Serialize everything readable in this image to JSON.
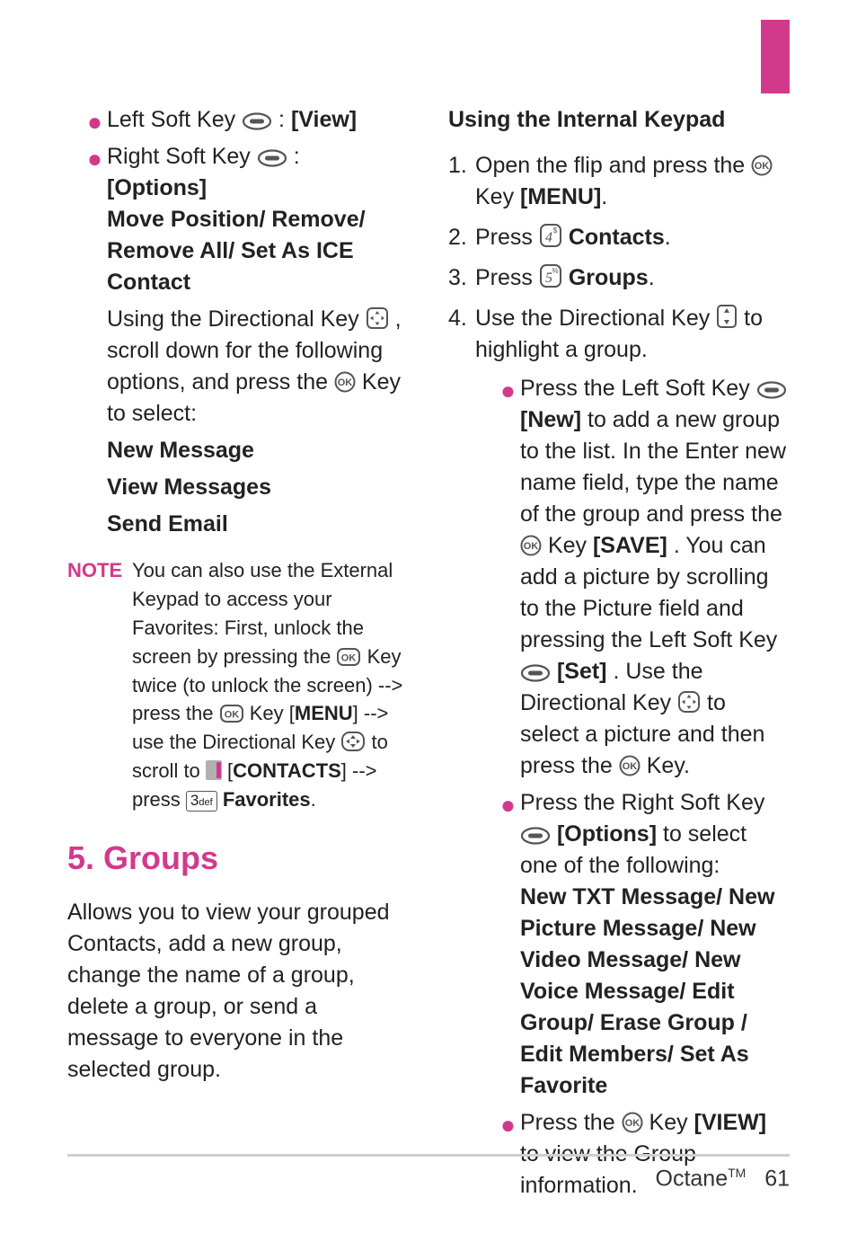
{
  "left": {
    "b1": {
      "pre": "Left Soft Key ",
      "post": ": ",
      "label": "[View]"
    },
    "b2": {
      "pre": "Right Soft Key ",
      "post": ":",
      "opt": "[Options]",
      "opts": "Move Position/ Remove/ Remove All/ Set As ICE Contact"
    },
    "dir_a": "Using the Directional Key ",
    "dir_b": ", scroll down for the following options, and press the ",
    "dir_c": " Key to select:",
    "opt1": "New Message",
    "opt2": "View Messages",
    "opt3": "Send Email",
    "note_label": "NOTE",
    "note_a": "You can also use the External Keypad to access your Favorites: First, unlock the screen by pressing the ",
    "note_b": " Key twice (to unlock the screen) --> press the ",
    "note_c": " Key [",
    "note_menu": "MENU",
    "note_d": "] --> use the Directional Key ",
    "note_e": " to scroll to ",
    "note_f": " [",
    "note_contacts": "CONTACTS",
    "note_g": "] --> press ",
    "note_h": " ",
    "note_fav": "Favorites",
    "note_i": ".",
    "section": "5. Groups",
    "para": "Allows you to view your grouped Contacts, add a new group, change the name of a group, delete a group, or send a message to everyone in the selected group."
  },
  "right": {
    "subhead": "Using the Internal Keypad",
    "s1a": "Open the flip and press the ",
    "s1b": " Key ",
    "s1menu": "[MENU]",
    "s1c": ".",
    "s2a": "Press ",
    "s2key": " ",
    "s2b": "Contacts",
    "s2c": ".",
    "s3a": "Press ",
    "s3b": "Groups",
    "s3c": ".",
    "s4a": "Use the Directional Key ",
    "s4b": " to highlight a group.",
    "sb1a": "Press the Left Soft Key ",
    "sb1new": "[New]",
    "sb1b": " to add a new group to the list. In the Enter new name field, type the name of the group and press the ",
    "sb1c": " Key ",
    "sb1save": "[SAVE]",
    "sb1d": ". You can add a picture by scrolling to the Picture field and pressing the Left Soft Key ",
    "sb1set": "[Set]",
    "sb1e": ". Use the Directional Key ",
    "sb1f": " to select a picture and then press the ",
    "sb1g": " Key.",
    "sb2a": "Press the Right Soft Key ",
    "sb2opt": "[Options]",
    "sb2b": " to select one of the following:",
    "sb2list": "New TXT Message/ New Picture Message/ New Video Message/ New Voice Message/ Edit Group/ Erase Group / Edit Members/ Set As Favorite",
    "sb3a": "Press the ",
    "sb3b": " Key ",
    "sb3view": "[VIEW]",
    "sb3c": " to view the Group information."
  },
  "footer": {
    "name": "Octane",
    "tm": "TM",
    "page": "61"
  },
  "nums": {
    "n1": "1.",
    "n2": "2.",
    "n3": "3.",
    "n4": "4."
  }
}
